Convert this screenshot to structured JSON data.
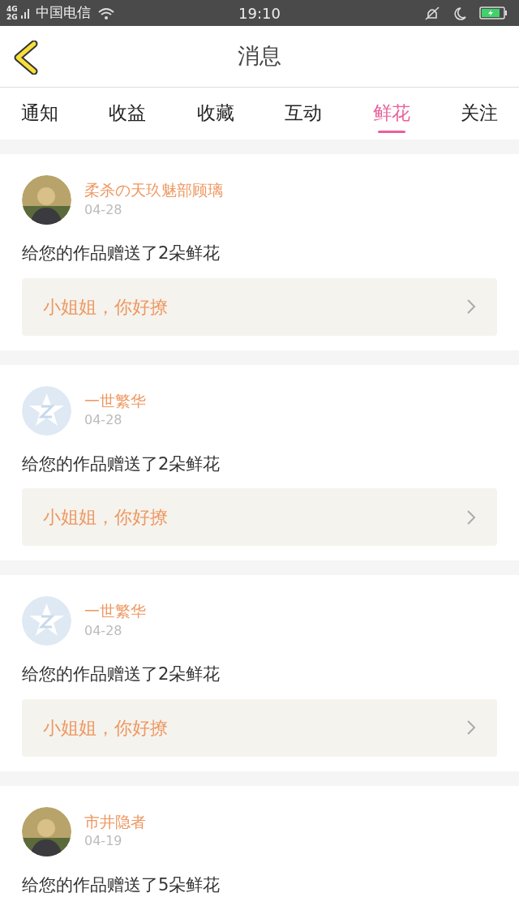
{
  "status_bar": {
    "network": [
      "4G",
      "2G"
    ],
    "carrier": "中国电信",
    "time": "19:10"
  },
  "header": {
    "title": "消息"
  },
  "tabs": [
    {
      "label": "通知",
      "selected": false
    },
    {
      "label": "收益",
      "selected": false
    },
    {
      "label": "收藏",
      "selected": false
    },
    {
      "label": "互动",
      "selected": false
    },
    {
      "label": "鲜花",
      "selected": true
    },
    {
      "label": "关注",
      "selected": false
    }
  ],
  "messages": [
    {
      "name": "柔杀の天玖魅部顾璃",
      "date": "04-28",
      "text": "给您的作品赠送了2朵鲜花",
      "message": "小姐姐，你好撩"
    },
    {
      "avatar": {
        "kind": "default"
      },
      "name": "一世繁华",
      "date": "04-28",
      "text": "给您的作品赠送了2朵鲜花",
      "message": "小姐姐，你好撩"
    },
    {
      "avatar": {
        "kind": "default"
      },
      "name": "一世繁华",
      "date": "04-28",
      "text": "给您的作品赠送了2朵鲜花",
      "message": "小姐姐，你好撩"
    },
    {
      "name": "市井隐者",
      "date": "04-19",
      "text": "给您的作品赠送了5朵鲜花"
    }
  ]
}
